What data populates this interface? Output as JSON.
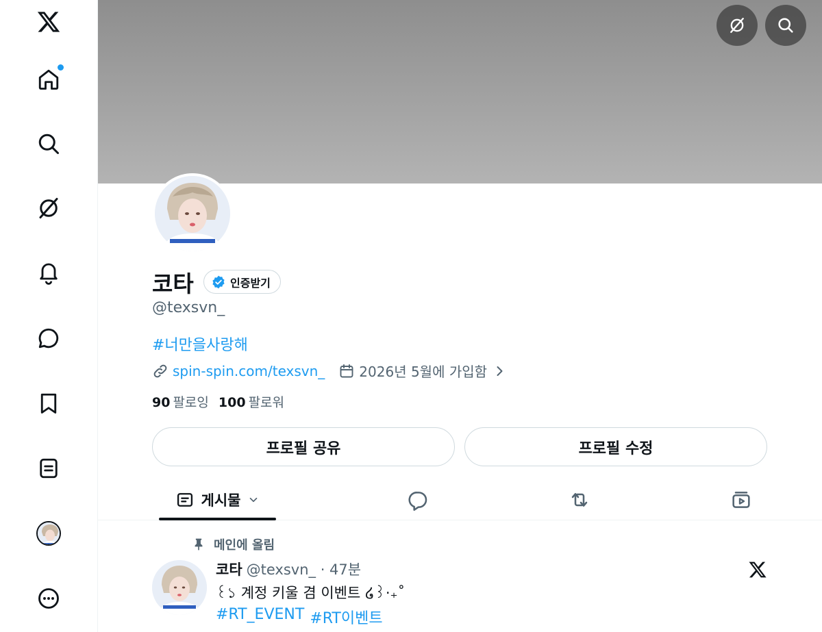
{
  "sidebar": {
    "items": [
      {
        "name": "x-logo",
        "icon": "x-logo-icon"
      },
      {
        "name": "home",
        "icon": "home-icon",
        "has_notification_dot": true
      },
      {
        "name": "explore",
        "icon": "search-icon"
      },
      {
        "name": "grok",
        "icon": "grok-icon"
      },
      {
        "name": "notifications",
        "icon": "bell-icon"
      },
      {
        "name": "messages",
        "icon": "chat-bubble-icon"
      },
      {
        "name": "bookmarks",
        "icon": "bookmark-icon"
      },
      {
        "name": "lists",
        "icon": "list-icon"
      },
      {
        "name": "profile",
        "icon": "avatar"
      },
      {
        "name": "more",
        "icon": "more-icon"
      }
    ]
  },
  "banner": {
    "buttons": [
      {
        "name": "grok",
        "icon": "grok-icon"
      },
      {
        "name": "search",
        "icon": "search-icon"
      }
    ]
  },
  "profile": {
    "name": "코타",
    "verify_label": "인증받기",
    "handle": "@texsvn_",
    "bio": "#너만을사랑해",
    "link": "spin-spin.com/texsvn_",
    "joined": "2026년 5월에 가입함",
    "following_count": "90",
    "following_label": "팔로잉",
    "followers_count": "100",
    "followers_label": "팔로워",
    "share_button": "프로필 공유",
    "edit_button": "프로필 수정"
  },
  "tabs": {
    "posts_label": "게시물",
    "items": [
      "posts",
      "replies",
      "reposts",
      "media"
    ]
  },
  "post": {
    "pinned_label": "메인에 올림",
    "author_name": "코타",
    "author_meta": "@texsvn_ · 47분",
    "text": "꒰১ 계정 키울 겸 이벤트 ໒꒱·₊˚",
    "tag1": "#RT_EVENT",
    "tag2": "#RT이벤트"
  },
  "colors": {
    "accent": "#1d9bf0",
    "text": "#0f1419",
    "muted": "#536471",
    "border": "#cfd9de"
  }
}
